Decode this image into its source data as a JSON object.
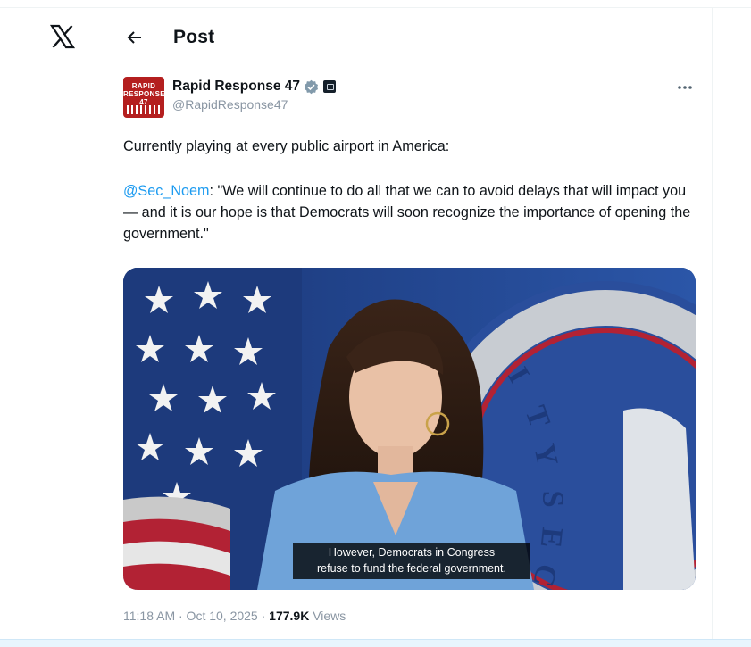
{
  "header": {
    "title": "Post"
  },
  "post": {
    "author": {
      "name": "Rapid Response 47",
      "handle": "@RapidResponse47"
    },
    "text_line1": "Currently playing at every public airport in America:",
    "mention": "@Sec_Noem",
    "quote_text": ": \"We will continue to do all that we can to avoid delays that will impact you — and it is our hope is that Democrats will soon recognize the importance of opening the government.\"",
    "video": {
      "caption_line1": "However, Democrats in Congress",
      "caption_line2": "refuse to fund the federal government."
    },
    "timestamp": "11:18 AM · Oct 10, 2025",
    "separator": " · ",
    "views_count": "177.9K",
    "views_label": " Views"
  },
  "colors": {
    "link": "#1d9bf0",
    "avatar_bg": "#b41f1f",
    "verified": "#829aab",
    "muted": "#8a96a3"
  },
  "icons": {
    "logo": "x-logo-icon",
    "back": "arrow-left-icon",
    "verified": "verified-badge-icon",
    "affiliate": "affiliate-badge-icon",
    "more": "more-horizontal-icon"
  }
}
